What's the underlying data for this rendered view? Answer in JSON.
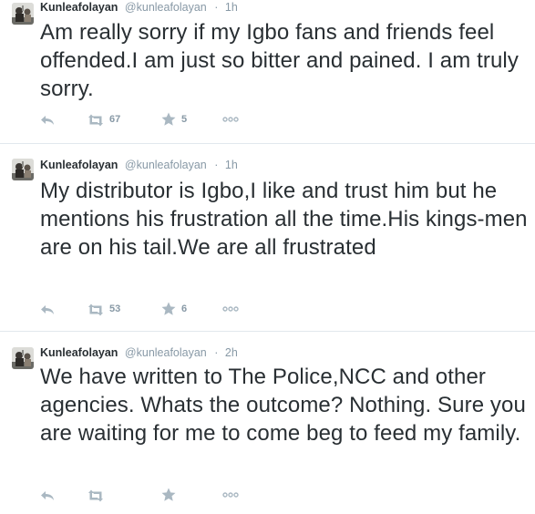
{
  "timeline": {
    "tweets": [
      {
        "name": "Kunleafolayan",
        "handle": "@kunleafolayan",
        "separator": "·",
        "time": "1h",
        "text": "Am really sorry if my Igbo fans and friends feel offended.I am just so bitter and pained. I am truly sorry.",
        "retweets": "67",
        "favorites": "5"
      },
      {
        "name": "Kunleafolayan",
        "handle": "@kunleafolayan",
        "separator": "·",
        "time": "1h",
        "text": "My distributor is Igbo,I like and trust him but he mentions his frustration all the time.His kings-men are on his tail.We are all frustrated",
        "retweets": "53",
        "favorites": "6"
      },
      {
        "name": "Kunleafolayan",
        "handle": "@kunleafolayan",
        "separator": "·",
        "time": "2h",
        "text": "We have written to The Police,NCC and other agencies. Whats the outcome? Nothing. Sure you are waiting for me to come beg to feed my family.",
        "retweets": "",
        "favorites": ""
      }
    ],
    "icons": {
      "reply": "reply-icon",
      "retweet": "retweet-icon",
      "favorite": "star-icon",
      "more": "more-icon",
      "avatar": "avatar-photo"
    },
    "colors": {
      "text": "#292f33",
      "muted": "#8899a6",
      "icon": "#aab8c2",
      "divider": "#e1e8ed"
    }
  }
}
